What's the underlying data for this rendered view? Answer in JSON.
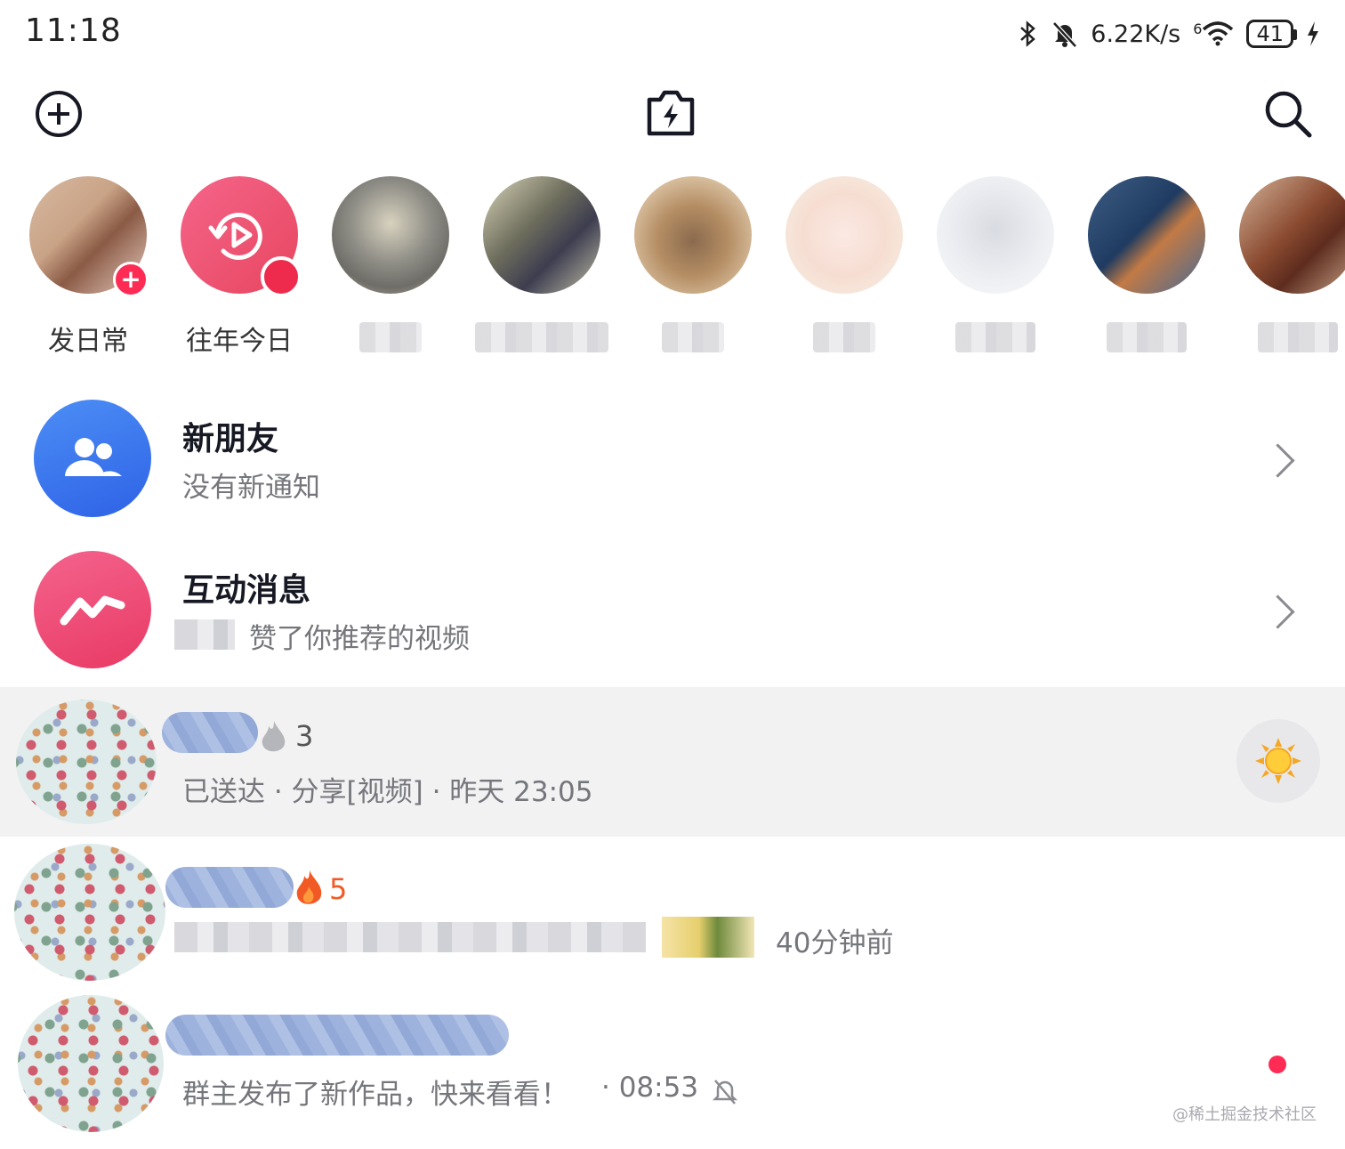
{
  "status_bar": {
    "time": "11:18",
    "network_speed": "6.22K/s",
    "signal_prefix": "6",
    "battery": "41",
    "icons": [
      "bluetooth-icon",
      "mute-bell-icon",
      "wifi-icon",
      "battery-icon",
      "charging-icon"
    ]
  },
  "top_bar": {
    "left_icon": "plus-circle-icon",
    "center_icon": "flash-camera-icon",
    "right_icon": "search-icon"
  },
  "stories": [
    {
      "label": "发日常",
      "has_add_badge": true
    },
    {
      "label": "往年今日",
      "has_red_dot": true
    },
    {
      "label": ""
    },
    {
      "label": ""
    },
    {
      "label": ""
    },
    {
      "label": ""
    },
    {
      "label": ""
    },
    {
      "label": ""
    },
    {
      "label": ""
    }
  ],
  "notifications": [
    {
      "title": "新朋友",
      "subtitle": "没有新通知",
      "icon": "friends-icon",
      "color": "#3a78f2"
    },
    {
      "title": "互动消息",
      "subtitle": "赞了你推荐的视频",
      "icon": "interaction-icon",
      "color": "#f0497a"
    }
  ],
  "chats": [
    {
      "streak_count": "3",
      "preview": "已送达 · 分享[视频] · 昨天 23:05",
      "highlighted": true,
      "streak_icon": "gray-flame-icon",
      "side_icon": "sun-icon"
    },
    {
      "streak_count": "5",
      "preview_time": "40分钟前",
      "streak_icon": "fire-icon"
    },
    {
      "preview": "群主发布了新作品，快来看看！",
      "time": "· 08:53",
      "muted": true,
      "unread_dot": true
    }
  ],
  "watermark": "@稀土掘金技术社区",
  "colors": {
    "accent_red": "#fe2c55",
    "primary_text": "#161823",
    "secondary_text": "#75767b",
    "highlight_row": "#f2f2f3"
  }
}
